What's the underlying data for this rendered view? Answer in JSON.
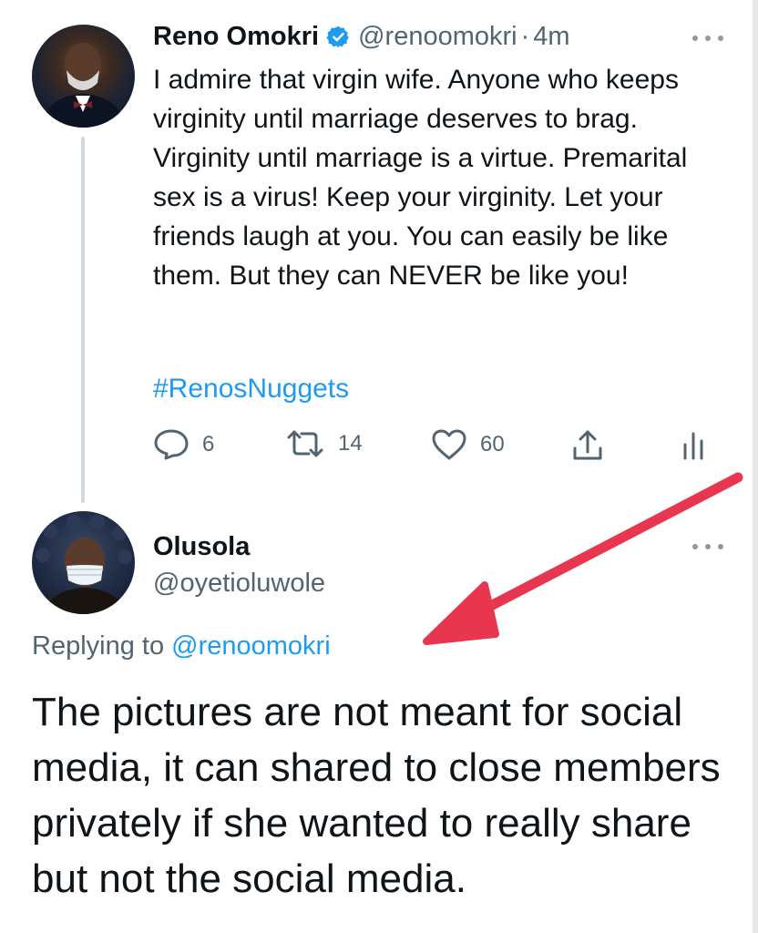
{
  "tweet": {
    "author_name": "Reno Omokri",
    "handle": "@renoomokri",
    "separator": "·",
    "time": "4m",
    "text": "I admire that virgin wife. Anyone who keeps virginity until marriage deserves to brag. Virginity until marriage is a virtue. Premarital sex is a virus! Keep your virginity. Let your friends laugh at you. You can easily be like them. But they can NEVER be like you!",
    "hashtag": "#RenosNuggets",
    "actions": {
      "reply_count": "6",
      "retweet_count": "14",
      "like_count": "60"
    }
  },
  "reply": {
    "author_name": "Olusola",
    "handle": "@oyetioluwole",
    "replying_prefix": "Replying to",
    "replying_mention": "@renoomokri",
    "text": "The pictures are not meant for social media, it can shared to close members privately if she wanted to really share but not the social media."
  },
  "colors": {
    "link_blue": "#1d9bf0",
    "secondary_gray": "#536471",
    "annotation_arrow": "#e8364f"
  },
  "icons": [
    "verified-badge-icon",
    "more-icon",
    "reply-icon",
    "retweet-icon",
    "like-icon",
    "share-icon",
    "analytics-icon",
    "annotation-arrow"
  ]
}
